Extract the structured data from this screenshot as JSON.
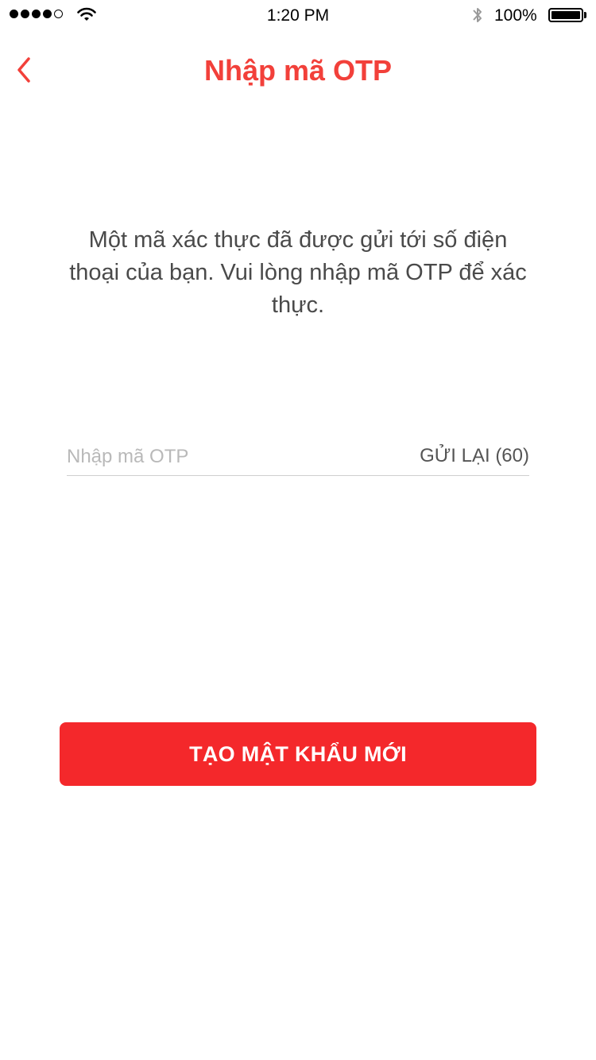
{
  "status_bar": {
    "time": "1:20 PM",
    "battery_percent": "100%",
    "signal_bars_filled": 4,
    "signal_bars_total": 5,
    "icons": [
      "signal-dots-icon",
      "wifi-icon",
      "bluetooth-icon",
      "battery-icon"
    ]
  },
  "nav": {
    "title": "Nhập mã OTP",
    "back_icon": "chevron-left-icon"
  },
  "main": {
    "description": "Một mã xác thực đã được gửi tới số điện thoại của bạn. Vui lòng nhập mã OTP để xác thực.",
    "otp_input": {
      "placeholder": "Nhập mã OTP",
      "value": ""
    },
    "resend_label": "GỬI LẠI (60)",
    "submit_label": "TẠO MẬT KHẨU MỚI"
  },
  "colors": {
    "accent": "#f2403a",
    "button_bg": "#f4282b",
    "text": "#4a4a4a",
    "placeholder": "#b9b9b9"
  }
}
